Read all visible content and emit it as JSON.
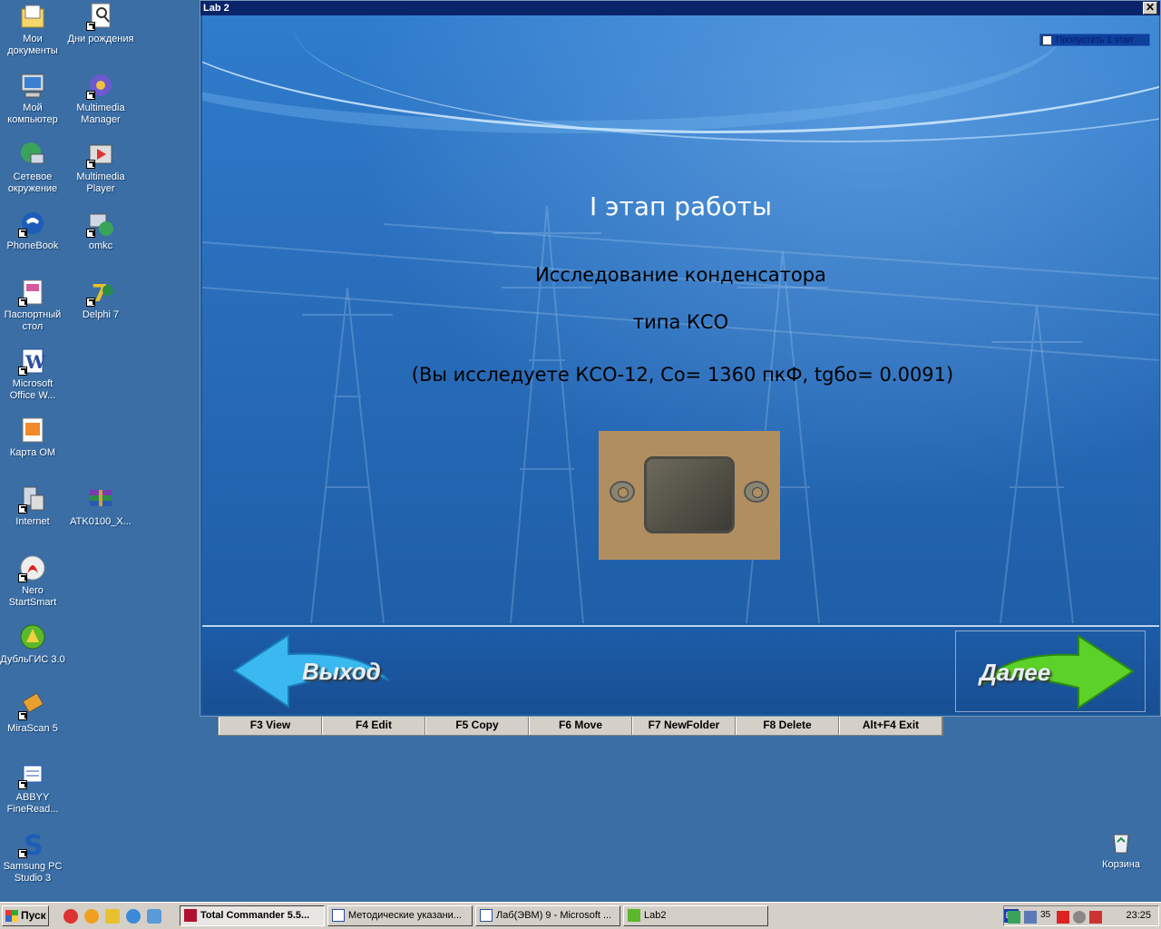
{
  "desktop": {
    "icons": [
      {
        "label": "Мои документы",
        "icon": "my-documents-icon"
      },
      {
        "label": "Дни рождения",
        "icon": "birthdays-icon"
      },
      {
        "label": "Мой компьютер",
        "icon": "my-computer-icon"
      },
      {
        "label": "Multimedia Manager",
        "icon": "multimedia-manager-icon"
      },
      {
        "label": "Сетевое окружение",
        "icon": "network-icon"
      },
      {
        "label": "Multimedia Player",
        "icon": "multimedia-player-icon"
      },
      {
        "label": "PhoneBook",
        "icon": "phonebook-icon"
      },
      {
        "label": "omkc",
        "icon": "omkc-icon"
      },
      {
        "label": "Паспортный стол",
        "icon": "passport-office-icon"
      },
      {
        "label": "Delphi 7",
        "icon": "delphi-icon"
      },
      {
        "label": "Microsoft Office W...",
        "icon": "word-icon"
      },
      {
        "label": "Карта ОМ",
        "icon": "map-icon"
      },
      {
        "label": "Internet",
        "icon": "internet-icon"
      },
      {
        "label": "ATK0100_X...",
        "icon": "winrar-archive-icon"
      },
      {
        "label": "Nero StartSmart",
        "icon": "nero-icon"
      },
      {
        "label": "ДубльГИС 3.0",
        "icon": "dublgis-icon"
      },
      {
        "label": "MiraScan 5",
        "icon": "mirascan-icon"
      },
      {
        "label": "ABBYY FineRead...",
        "icon": "abbyy-icon"
      },
      {
        "label": "Samsung PC Studio 3",
        "icon": "samsung-pc-studio-icon"
      }
    ],
    "recycle_bin": "Корзина"
  },
  "total_commander": {
    "fkeys": [
      "F3 View",
      "F4 Edit",
      "F5 Copy",
      "F6 Move",
      "F7 NewFolder",
      "F8 Delete",
      "Alt+F4 Exit"
    ]
  },
  "lab_window": {
    "title": "Lab 2",
    "close": "✕",
    "skip_label": "Пропустить 1 этап",
    "stage_title": "I этап работы",
    "line1": "Исследование конденсатора",
    "line2": "типа КСО",
    "line3": "(Вы исследуете КСО-12,  Со= 1360 пкФ, tgбо= 0.0091)",
    "exit_label": "Выход",
    "next_label": "Далее",
    "colors": {
      "exit_arrow": "#3ab8f0",
      "next_arrow": "#5cd12a"
    }
  },
  "taskbar": {
    "start": "Пуск",
    "tasks": [
      {
        "label": "Total Commander 5.5...",
        "active": true
      },
      {
        "label": "Методические указани...",
        "active": false
      },
      {
        "label": "Лаб(ЭВМ) 9 - Microsoft ...",
        "active": false
      },
      {
        "label": "Lab2",
        "active": false
      }
    ],
    "lang": "EN",
    "tray_temp": "35",
    "clock": "23:25"
  }
}
